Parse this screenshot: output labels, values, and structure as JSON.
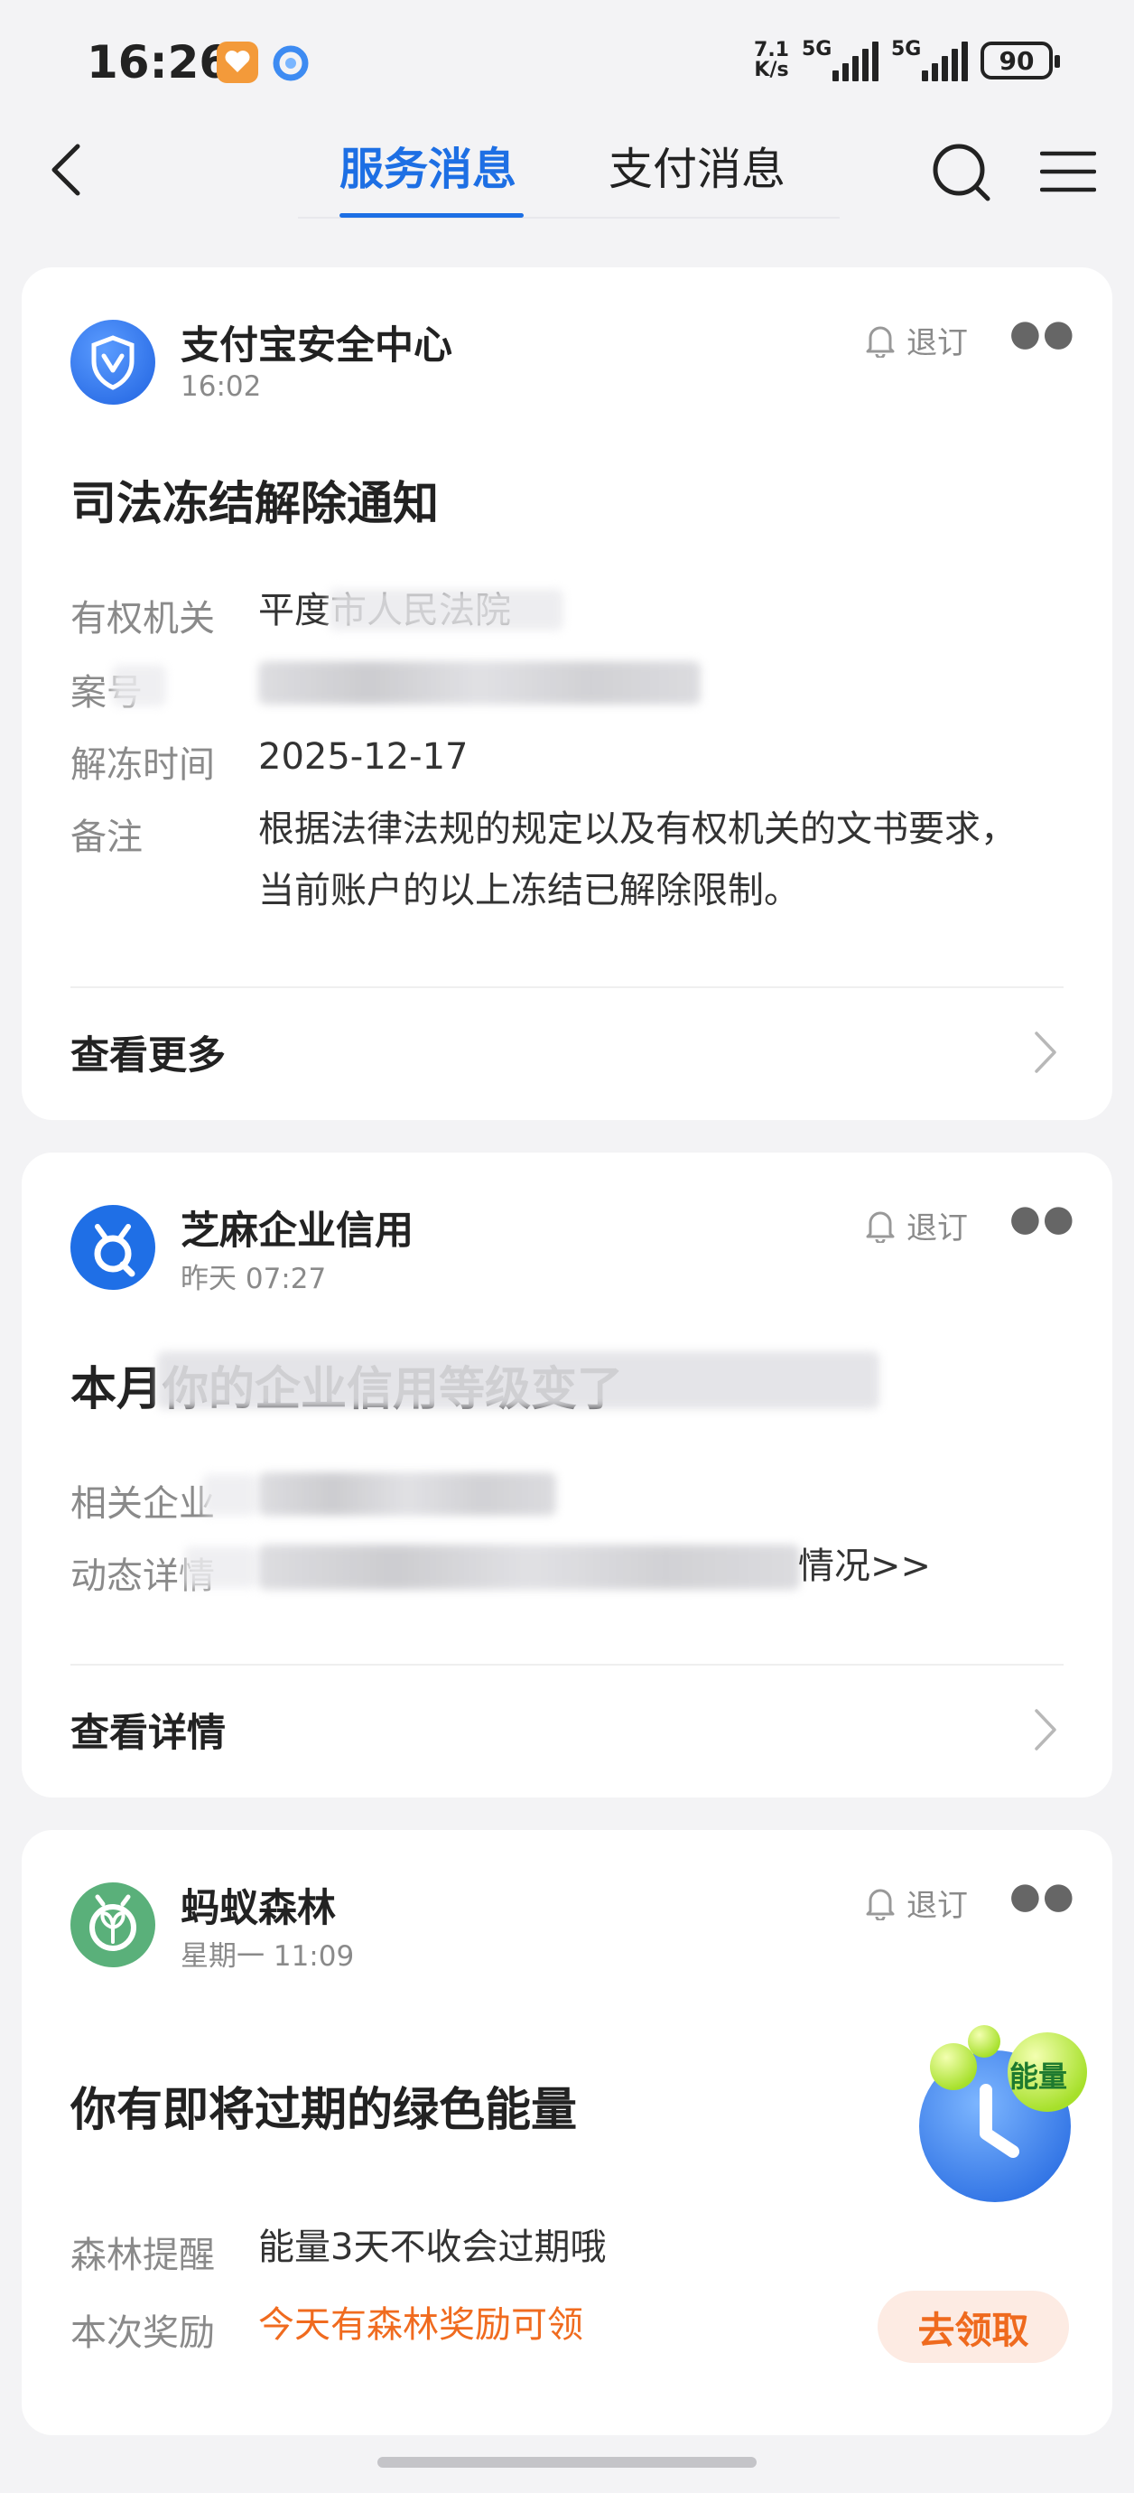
{
  "status_bar": {
    "time": "16:26",
    "net_speed_top": "7.1",
    "net_speed_bottom": "K/s",
    "signal1": "5G",
    "signal2": "5G",
    "battery": "90"
  },
  "nav": {
    "tabs": [
      "服务消息",
      "支付消息"
    ],
    "active_tab": 0
  },
  "cards": [
    {
      "source": "支付宝安全中心",
      "time": "16:02",
      "unsubscribe": "退订",
      "title": "司法冻结解除通知",
      "fields": [
        {
          "label": "有权机关",
          "value": "平度市人民法院"
        },
        {
          "label": "案号",
          "value": ""
        },
        {
          "label": "解冻时间",
          "value": "2025-12-17"
        },
        {
          "label": "备注",
          "value": "根据法律法规的规定以及有权机关的文书要求，当前账户的以上冻结已解除限制。"
        }
      ],
      "footer": "查看更多",
      "icon": "shield-v-icon"
    },
    {
      "source": "芝麻企业信用",
      "time": "昨天 07:27",
      "unsubscribe": "退订",
      "title": "本月你的企业信用等级变了",
      "fields": [
        {
          "label": "相关企业",
          "value": ""
        },
        {
          "label": "动态详情",
          "value": "情况>>"
        }
      ],
      "footer": "查看详情",
      "icon": "sesame-credit-icon"
    },
    {
      "source": "蚂蚁森林",
      "time": "星期一 11:09",
      "unsubscribe": "退订",
      "title": "你有即将过期的绿色能量",
      "fields": [
        {
          "label": "森林提醒",
          "value": "能量3天不收会过期哦"
        },
        {
          "label": "本次奖励",
          "value": "今天有森林奖励可领"
        }
      ],
      "energy_badge": "能量",
      "claim_button": "去领取",
      "icon": "sprout-icon"
    }
  ],
  "colors": {
    "accent": "#1d6fe4",
    "orange": "#f06b1f",
    "background": "#f3f3f5"
  }
}
